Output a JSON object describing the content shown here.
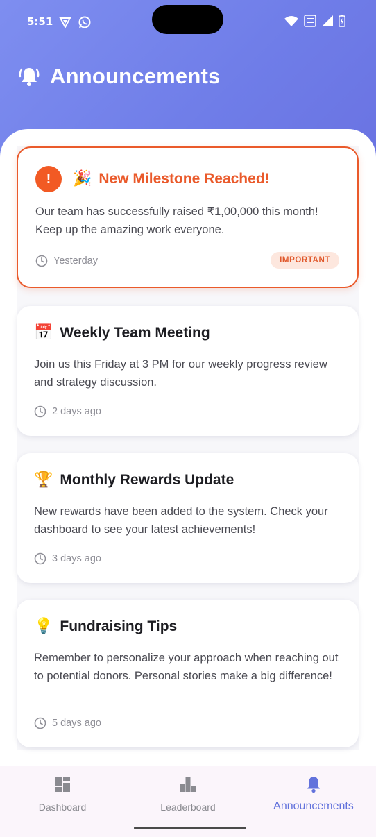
{
  "status_bar": {
    "time": "5:51"
  },
  "header": {
    "title": "Announcements",
    "icon": "bell-ringing-icon"
  },
  "announcements": [
    {
      "title": "New Milestone Reached!",
      "emoji": "🎉",
      "body": "Our team has successfully raised ₹1,00,000 this month! Keep up the amazing work everyone.",
      "time": "Yesterday",
      "badge": "IMPORTANT",
      "important": true
    },
    {
      "title": "Weekly Team Meeting",
      "emoji": "📅",
      "body": "Join us this Friday at 3 PM for our weekly progress review and strategy discussion.",
      "time": "2 days ago"
    },
    {
      "title": "Monthly Rewards Update",
      "emoji": "🏆",
      "body": "New rewards have been added to the system. Check your dashboard to see your latest achievements!",
      "time": "3 days ago"
    },
    {
      "title": "Fundraising Tips",
      "emoji": "💡",
      "body": "Remember to personalize your approach when reaching out to potential donors. Personal stories make a big difference!",
      "time": "5 days ago"
    }
  ],
  "bottom_nav": {
    "items": [
      {
        "label": "Dashboard",
        "icon": "dashboard-icon"
      },
      {
        "label": "Leaderboard",
        "icon": "bar-chart-icon"
      },
      {
        "label": "Announcements",
        "icon": "bell-icon",
        "active": true
      }
    ]
  },
  "colors": {
    "header_gradient_start": "#7e8ef0",
    "header_gradient_end": "#6a73e2",
    "important_accent": "#ea5a2b",
    "nav_active": "#6272dc"
  }
}
